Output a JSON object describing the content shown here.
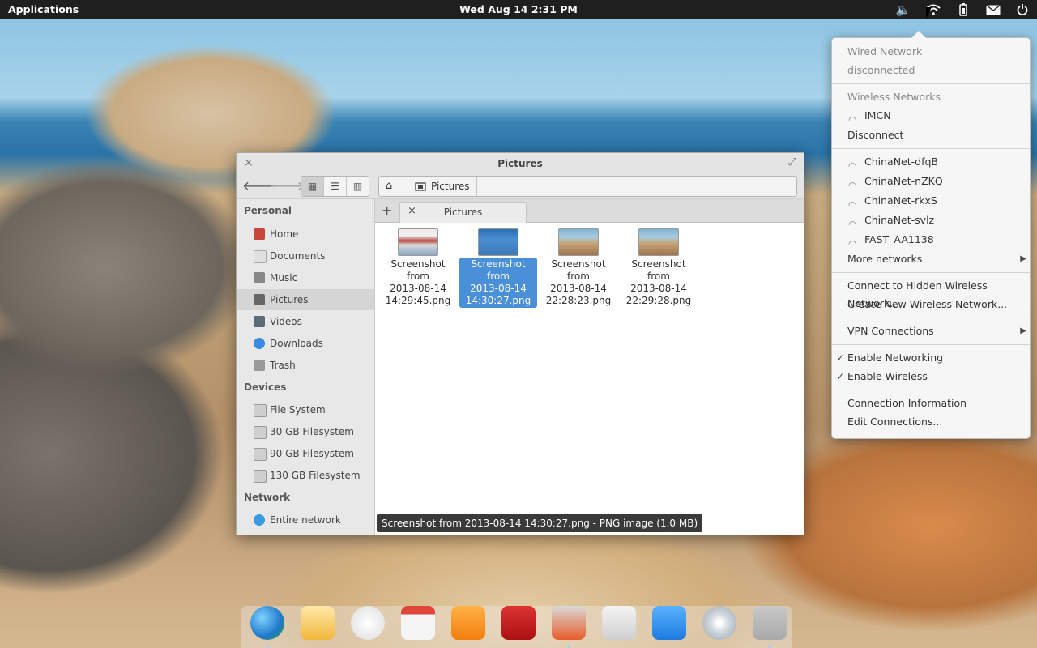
{
  "topbar": {
    "applications": "Applications",
    "clock": "Wed Aug 14  2:31 PM",
    "tray_icons": [
      "volume-icon",
      "wifi-icon",
      "battery-icon",
      "mail-icon",
      "power-icon"
    ]
  },
  "window": {
    "title": "Pictures",
    "close": "×",
    "maximize": "⤢",
    "views": [
      "icon-view",
      "list-view",
      "column-view"
    ],
    "path": {
      "home": "⌂",
      "crumb": "Pictures"
    }
  },
  "sidebar": {
    "personal": "Personal",
    "personal_items": [
      {
        "label": "Home",
        "color": "#c8453a"
      },
      {
        "label": "Documents",
        "color": "#e0e0e0"
      },
      {
        "label": "Music",
        "color": "#888888"
      },
      {
        "label": "Pictures",
        "color": "#666666"
      },
      {
        "label": "Videos",
        "color": "#5b6b7a"
      },
      {
        "label": "Downloads",
        "color": "#3b8be0"
      },
      {
        "label": "Trash",
        "color": "#999999"
      }
    ],
    "devices": "Devices",
    "device_items": [
      {
        "label": "File System"
      },
      {
        "label": "30 GB Filesystem"
      },
      {
        "label": "90 GB Filesystem"
      },
      {
        "label": "130 GB Filesystem"
      }
    ],
    "network": "Network",
    "network_items": [
      {
        "label": "Entire network"
      }
    ]
  },
  "tabs": {
    "add": "+",
    "close": "×",
    "active": "Pictures"
  },
  "files": [
    {
      "line1": "Screenshot from",
      "line2": "2013-08-14",
      "line3": "14:29:45.png"
    },
    {
      "line1": "Screenshot from",
      "line2": "2013-08-14",
      "line3": "14:30:27.png"
    },
    {
      "line1": "Screenshot from",
      "line2": "2013-08-14",
      "line3": "22:28:23.png"
    },
    {
      "line1": "Screenshot from",
      "line2": "2013-08-14",
      "line3": "22:29:28.png"
    }
  ],
  "status": "Screenshot from 2013-08-14 14:30:27.png - PNG image (1.0 MB)",
  "network_menu": {
    "wired_header": "Wired Network",
    "wired_status": "disconnected",
    "wireless_header": "Wireless Networks",
    "connected": "IMCN",
    "disconnect": "Disconnect",
    "networks": [
      "ChinaNet-dfqB",
      "ChinaNet-nZKQ",
      "ChinaNet-rkxS",
      "ChinaNet-svlz",
      "FAST_AA1138"
    ],
    "more": "More networks",
    "hidden": "Connect to Hidden Wireless Network...",
    "create": "Create New Wireless Network...",
    "vpn": "VPN Connections",
    "enable_networking": "Enable Networking",
    "enable_wireless": "Enable Wireless",
    "info": "Connection Information",
    "edit": "Edit Connections..."
  },
  "dock": [
    "browser-icon",
    "mail-icon",
    "notes-icon",
    "calendar-icon",
    "music-icon",
    "video-icon",
    "photos-icon",
    "settings-icon",
    "downloads-icon",
    "disc-icon",
    "home-folder-icon"
  ]
}
